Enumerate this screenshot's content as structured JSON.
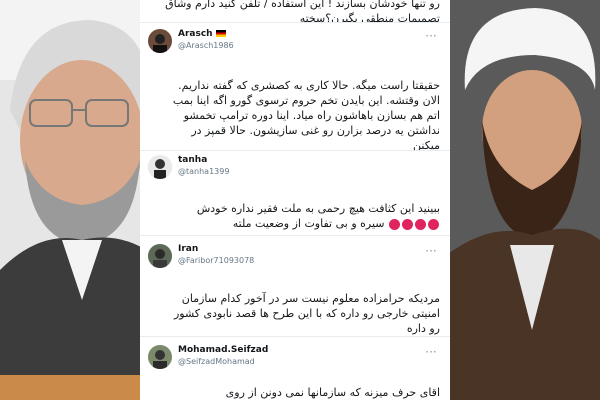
{
  "photos": {
    "left_icon": "man-portrait-glasses",
    "right_icon": "cleric-portrait-turban"
  },
  "tweets": [
    {
      "text_lines": [
        "رو تنها خودشان بسازند ! این استفاده / تلفن کنید دارم وشاق",
        "تصمیمات منطقی بگیرن؟سخته"
      ]
    },
    {
      "name": "Arasch",
      "handle": "@Arasch1986",
      "flag_icon": "germany-flag-icon",
      "text_lines": [
        "حقیقتا راست میگه. حالا کاری به کصشری که گفته نداریم.",
        "الان وقتشه. این بایدن تخم حروم ترسوی گورو اگه اینا بمب",
        "اتم هم بسازن باهاشون راه میاد. اینا دوره ترامپ تخمشو",
        "نداشتن یه درصد بزارن رو غنی سازیشون. حالا قمپز در",
        "میکنن"
      ]
    },
    {
      "name": "tanha",
      "handle": "@tanha1399",
      "text_lines": [
        "ببینید این کثافت هیچ رحمی به ملت فقیر نداره خودش",
        "سیره و بی تفاوت از وضعیت ملته"
      ],
      "emoji_icon": "angry-face-icon"
    },
    {
      "name": "Iran",
      "handle": "@Faribor71093078",
      "text_lines": [
        "مردیکه حرامزاده معلوم نیست سر در آخور کدام سازمان",
        "امنیتی خارجی رو داره که با این طرح ها قصد نابودی کشور",
        "رو داره"
      ]
    },
    {
      "name": "Mohamad.Seifzad",
      "handle": "@SeifzadMohamad",
      "text_lines": [
        "اقای حرف میزنه که سازمانها نمی دونن از روی"
      ]
    }
  ],
  "colors": {
    "text": "#14171a",
    "handle": "#657786",
    "emoji": "#e0245e"
  }
}
